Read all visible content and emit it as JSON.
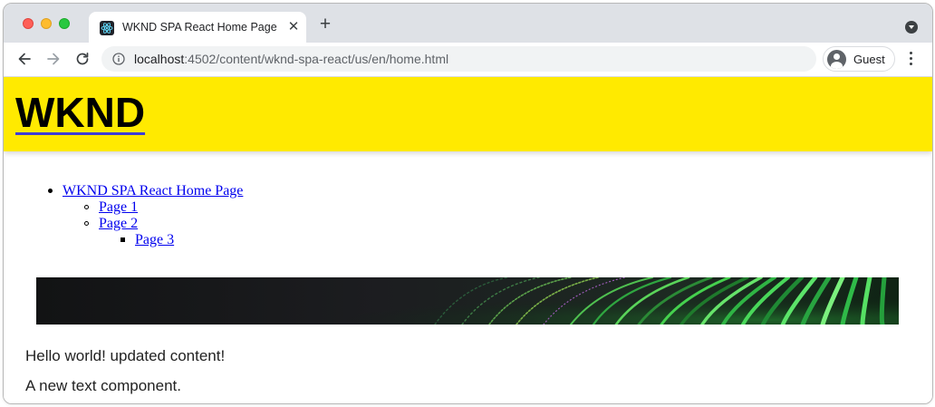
{
  "browser": {
    "tab": {
      "title": "WKND SPA React Home Page",
      "favicon": "react-icon"
    },
    "address_bar": {
      "host": "localhost",
      "path": ":4502/content/wknd-spa-react/us/en/home.html"
    },
    "profile": {
      "label": "Guest"
    },
    "colors": {
      "tabstrip": "#dee1e6",
      "omnibox": "#f1f3f4"
    }
  },
  "page": {
    "header": {
      "logo": "WKND",
      "background": "#ffea00"
    },
    "navigation": {
      "root": "WKND SPA React Home Page",
      "children": [
        "Page 1",
        "Page 2"
      ],
      "grandchildren": [
        "Page 3"
      ]
    },
    "banner": {
      "icon": "abstract-green-rings-image"
    },
    "text_components": [
      "Hello world! updated content!",
      "A new text component."
    ]
  }
}
